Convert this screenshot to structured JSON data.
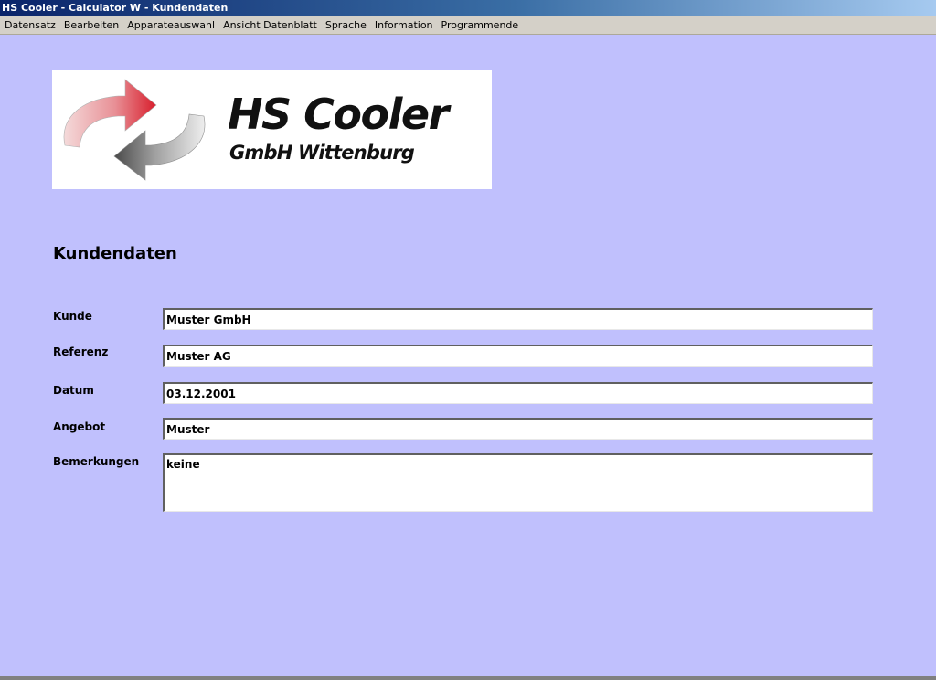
{
  "window": {
    "title": "HS Cooler - Calculator W - Kundendaten"
  },
  "menu": {
    "items": [
      "Datensatz",
      "Bearbeiten",
      "Apparateauswahl",
      "Ansicht Datenblatt",
      "Sprache",
      "Information",
      "Programmende"
    ]
  },
  "logo": {
    "title": "HS Cooler",
    "subtitle": "GmbH Wittenburg",
    "icon": "circular-arrows-icon",
    "arrow_top_color": "#d81e2c",
    "arrow_bottom_color": "#4a4a4a"
  },
  "form": {
    "heading": "Kundendaten",
    "fields": {
      "kunde": {
        "label": "Kunde",
        "value": "Muster GmbH"
      },
      "referenz": {
        "label": "Referenz",
        "value": "Muster AG"
      },
      "datum": {
        "label": "Datum",
        "value": "03.12.2001"
      },
      "angebot": {
        "label": "Angebot",
        "value": "Muster"
      },
      "bemerkungen": {
        "label": "Bemerkungen",
        "value": "keine"
      }
    }
  },
  "colors": {
    "background": "#c0c0fd",
    "menubar": "#d4d0c8",
    "titlebar_start": "#0a246a",
    "titlebar_end": "#a6caf0"
  }
}
